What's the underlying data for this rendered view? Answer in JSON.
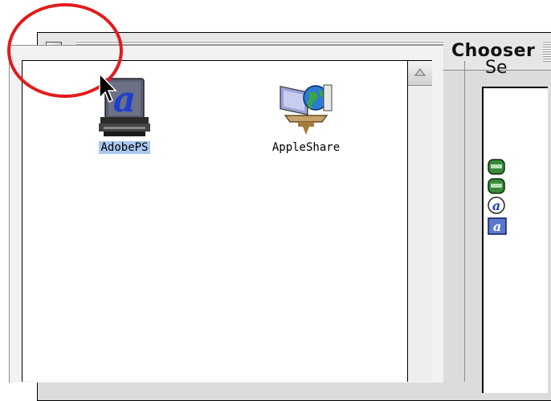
{
  "window": {
    "title": "Chooser"
  },
  "device_list": {
    "items": [
      {
        "label": "AdobePS",
        "icon": "adobeps-printer-icon",
        "selected": true
      },
      {
        "label": "AppleShare",
        "icon": "appleshare-icon",
        "selected": false
      }
    ]
  },
  "right_panel": {
    "label_partial": "Se"
  },
  "colors": {
    "annotation": "#e31b1b",
    "selection": "#a9c8f0"
  }
}
